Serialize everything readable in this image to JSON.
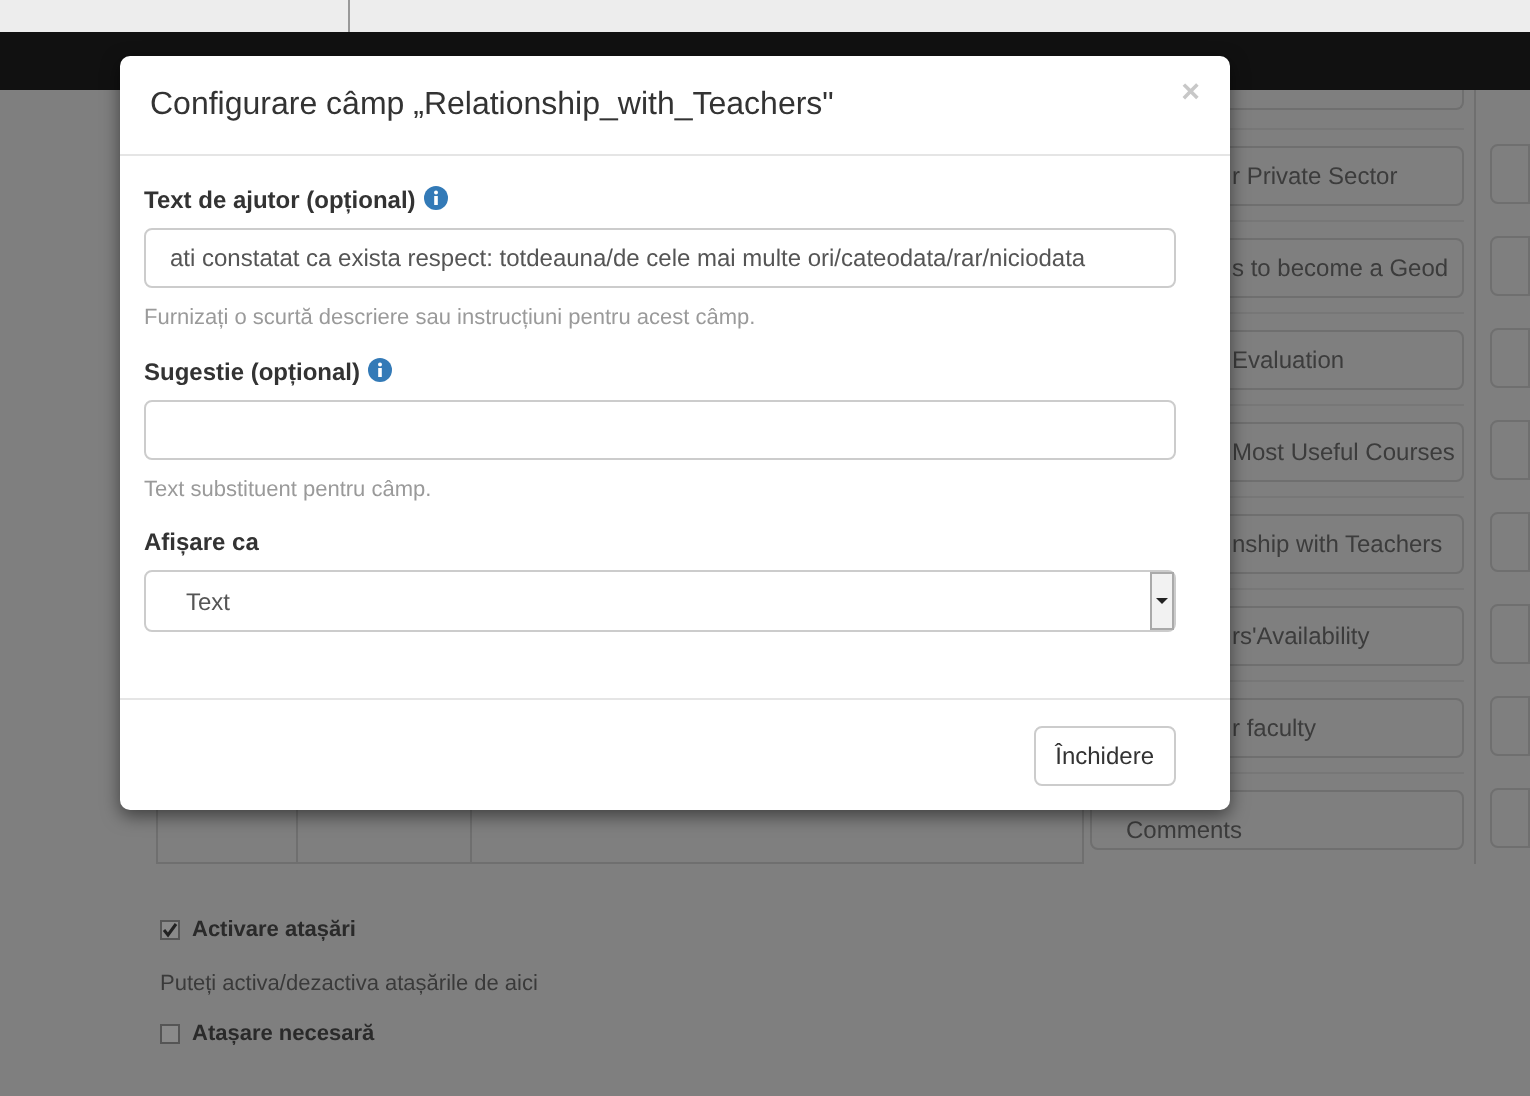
{
  "background": {
    "fields": [
      {
        "text": "r Private Sector"
      },
      {
        "text": "s to become a Geod"
      },
      {
        "text": "Evaluation"
      },
      {
        "text": "Most Useful Courses"
      },
      {
        "text": "nship with Teachers"
      },
      {
        "text": "rs'Availability"
      },
      {
        "text": "r faculty"
      },
      {
        "text": "Comments"
      }
    ],
    "options": [
      {
        "kind": "checkbox",
        "label": "Activare atașări",
        "checked": true
      },
      {
        "kind": "note",
        "label": "Puteți activa/dezactiva atașările de aici"
      },
      {
        "kind": "checkbox",
        "label": "Atașare necesară",
        "checked": false
      }
    ]
  },
  "modal": {
    "title": "Configurare câmp „Relationship_with_Teachers\"",
    "close": "×",
    "fields": [
      {
        "kind": "input",
        "label": "Text de ajutor (opțional)",
        "info": true,
        "value": "ati constatat ca exista respect: totdeauna/de cele mai multe ori/cateodata/rar/niciodata",
        "help": "Furnizați o scurtă descriere sau instrucțiuni pentru acest câmp."
      },
      {
        "kind": "input",
        "label": "Sugestie (opțional)",
        "info": true,
        "help": "Text substituent pentru câmp."
      },
      {
        "kind": "select",
        "label": "Afișare ca",
        "value": "Text"
      }
    ],
    "button": "Închidere"
  }
}
